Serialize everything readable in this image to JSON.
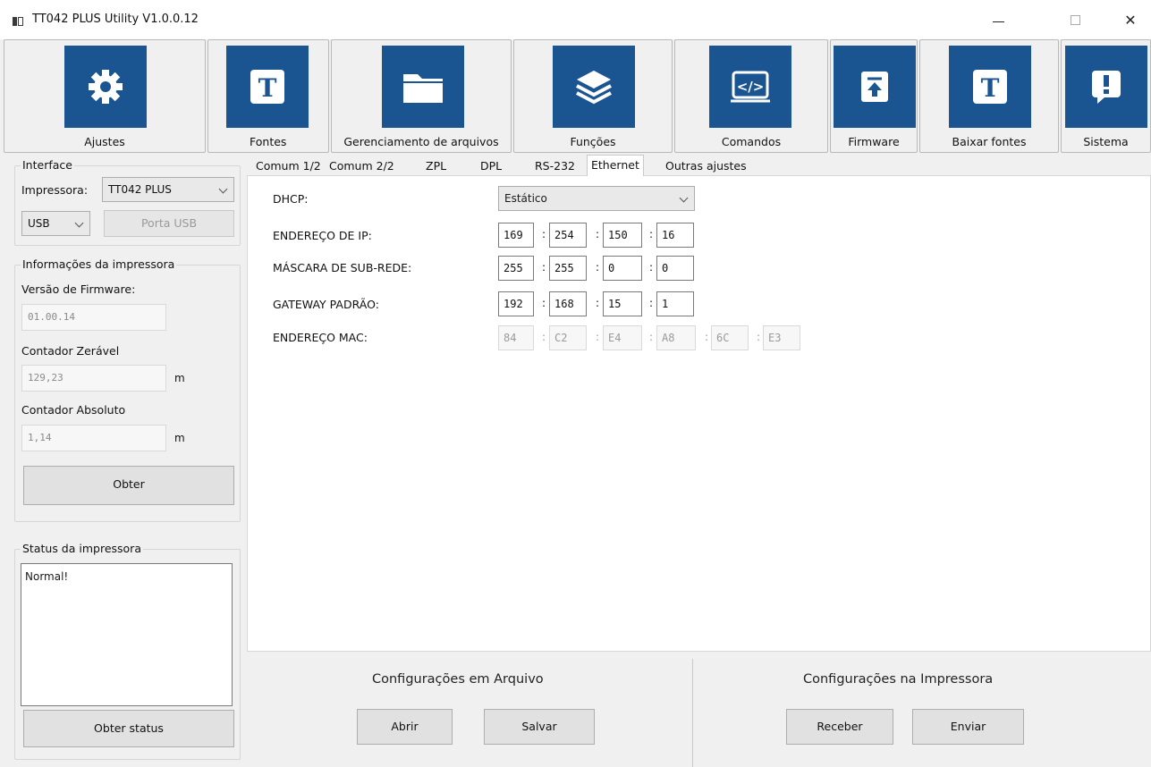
{
  "window": {
    "title": "TT042 PLUS Utility  V1.0.0.12"
  },
  "toolbar": [
    {
      "label": "Ajustes",
      "icon": "gear-icon"
    },
    {
      "label": "Fontes",
      "icon": "font-t-icon"
    },
    {
      "label": "Gerenciamento de arquivos",
      "icon": "folder-icon"
    },
    {
      "label": "Funções",
      "icon": "layers-icon"
    },
    {
      "label": "Comandos",
      "icon": "code-icon"
    },
    {
      "label": "Firmware",
      "icon": "upload-icon"
    },
    {
      "label": "Baixar fontes",
      "icon": "font-t-icon"
    },
    {
      "label": "Sistema",
      "icon": "exclamation-icon"
    }
  ],
  "interface": {
    "title": "Interface",
    "printer_label": "Impressora:",
    "printer_value": "TT042 PLUS",
    "port_value": "USB",
    "port_button": "Porta USB"
  },
  "printer_info": {
    "title": "Informações da impressora",
    "firmware_label": "Versão de Firmware:",
    "firmware_value": "01.00.14",
    "reset_counter_label": "Contador Zerável",
    "reset_counter_value": "129,23",
    "reset_counter_unit": "m",
    "abs_counter_label": "Contador Absoluto",
    "abs_counter_value": "1,14",
    "abs_counter_unit": "m",
    "get_button": "Obter"
  },
  "printer_status": {
    "title": "Status da impressora",
    "text": "Normal!",
    "button": "Obter status"
  },
  "tabs": [
    "Comum 1/2",
    "Comum 2/2",
    "ZPL",
    "DPL",
    "RS-232",
    "Ethernet",
    "Outras ajustes"
  ],
  "active_tab": "Ethernet",
  "ethernet": {
    "dhcp_label": "DHCP:",
    "dhcp_value": "Estático",
    "ip_label": "ENDEREÇO DE IP:",
    "ip": [
      "169",
      "254",
      "150",
      "16"
    ],
    "mask_label": "MÁSCARA DE SUB-REDE:",
    "mask": [
      "255",
      "255",
      "0",
      "0"
    ],
    "gateway_label": "GATEWAY PADRÃO:",
    "gateway": [
      "192",
      "168",
      "15",
      "1"
    ],
    "mac_label": "ENDEREÇO MAC:",
    "mac": [
      "84",
      "C2",
      "E4",
      "A8",
      "6C",
      "E3"
    ],
    "separator": ":"
  },
  "file_config": {
    "title": "Configurações em Arquivo",
    "open": "Abrir",
    "save": "Salvar"
  },
  "printer_config": {
    "title": "Configurações na Impressora",
    "receive": "Receber",
    "send": "Enviar"
  },
  "colors": {
    "tile_blue": "#1a5591",
    "window_bg": "#f0f0f0"
  }
}
